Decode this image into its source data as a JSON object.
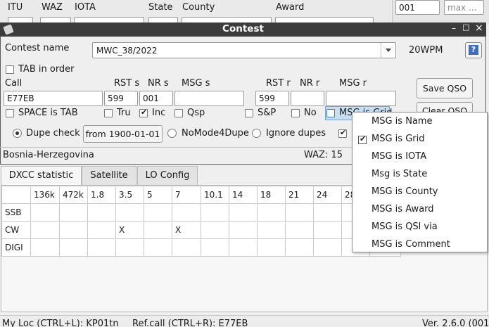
{
  "background": {
    "headers": {
      "itu": "ITU",
      "waz": "WAZ",
      "iota": "IOTA",
      "state": "State",
      "county": "County",
      "award": "Award"
    },
    "right_field_value": "001",
    "right_field_placeholder": "max ..."
  },
  "window": {
    "title": "Contest",
    "buttons": [
      "–",
      "□",
      "×"
    ]
  },
  "contest": {
    "name_label": "Contest name",
    "name_value": "MWC_38/2022",
    "speed": "20WPM",
    "help_icon": "?",
    "tab_in_order_label": "TAB in order"
  },
  "qso": {
    "headers": {
      "call": "Call",
      "rst_s": "RST s",
      "nr_s": "NR s",
      "msg_s": "MSG s",
      "rst_r": "RST r",
      "nr_r": "NR r",
      "msg_r": "MSG r"
    },
    "call": "E77EB",
    "rst_s": "599",
    "nr_s": "001",
    "msg_s": "",
    "rst_r": "599",
    "nr_r": "",
    "msg_r": "",
    "save_label": "Save QSO",
    "clear_label": "Clear QSO"
  },
  "options": {
    "space_is_tab": "SPACE is TAB",
    "tru": "Tru",
    "inc": "Inc",
    "qsp": "Qsp",
    "snp": "S&P",
    "no": "No",
    "msg_is_grid": "MSG is Grid",
    "dupe_check": "Dupe check",
    "from_date": "from 1900-01-01",
    "nomode4dupe": "NoMode4Dupe",
    "ignore_dupes": "Ignore dupes"
  },
  "status": {
    "country": "Bosnia-Herzegovina",
    "waz": "WAZ: 15"
  },
  "tabs": [
    "DXCC statistic",
    "Satellite",
    "LO Config"
  ],
  "stats": {
    "bands": [
      "136k",
      "472k",
      "1.8",
      "3.5",
      "5",
      "7",
      "10.1",
      "14",
      "18",
      "21",
      "24",
      "28"
    ],
    "rows": [
      {
        "mode": "SSB",
        "cells": [
          "",
          "",
          "",
          "",
          "",
          "",
          "",
          "",
          "",
          "",
          "",
          ""
        ]
      },
      {
        "mode": "CW",
        "cells": [
          "",
          "",
          "",
          "X",
          "",
          "X",
          "",
          "",
          "",
          "",
          "",
          ""
        ]
      },
      {
        "mode": "DIGI",
        "cells": [
          "",
          "",
          "",
          "",
          "",
          "",
          "",
          "",
          "",
          "",
          "",
          ""
        ]
      }
    ]
  },
  "menu": {
    "items": [
      "MSG is Name",
      "MSG is Grid",
      "MSG is IOTA",
      "Msg is State",
      "MSG is County",
      "MSG is Award",
      "MSG is QSl via",
      "MSG is Comment"
    ],
    "checked_index": 1
  },
  "footer": {
    "my_loc": "My Loc (CTRL+L): KP01tn",
    "ref_call": "Ref.call (CTRL+R): E77EB",
    "version": "Ver. 2.6.0 (001"
  },
  "colors": {
    "title_bar": "#3c3c3c",
    "window_bg": "#efefef",
    "highlight": "#c9def3"
  }
}
